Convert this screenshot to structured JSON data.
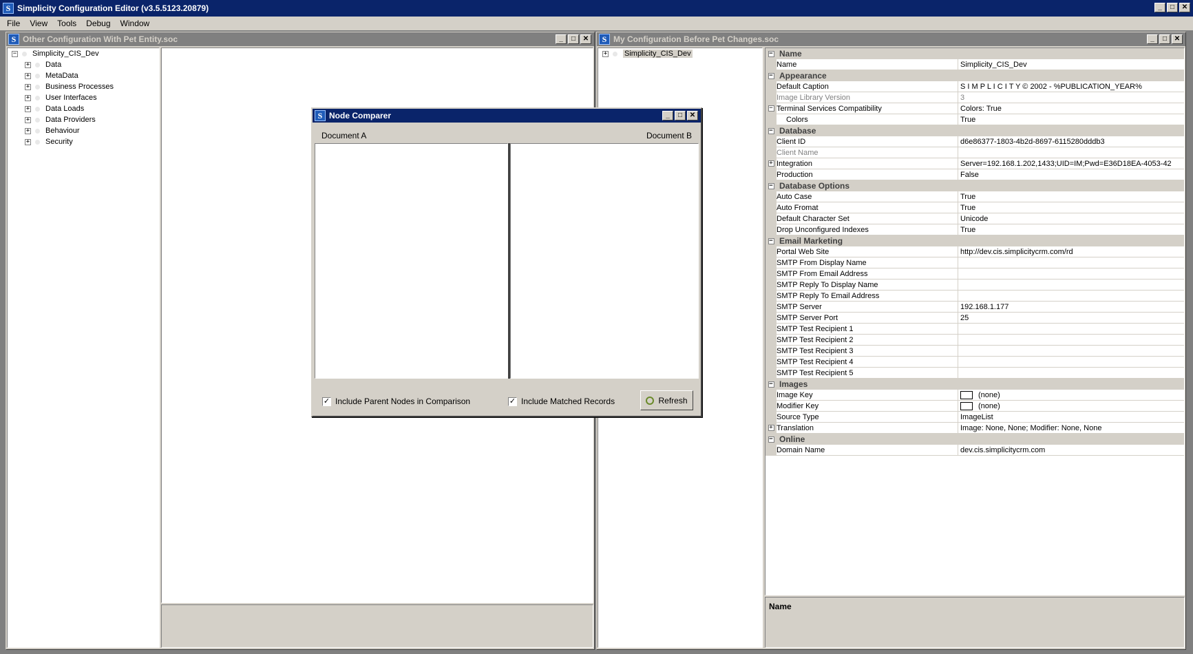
{
  "app": {
    "title": "Simplicity Configuration Editor (v3.5.5123.20879)",
    "icon_letter": "S",
    "min": "_",
    "max": "□",
    "close": "✕"
  },
  "menu": [
    "File",
    "View",
    "Tools",
    "Debug",
    "Window"
  ],
  "left_window": {
    "title": "Other Configuration With Pet Entity.soc",
    "root": "Simplicity_CIS_Dev",
    "children": [
      "Data",
      "MetaData",
      "Business Processes",
      "User Interfaces",
      "Data Loads",
      "Data Providers",
      "Behaviour",
      "Security"
    ]
  },
  "right_window": {
    "title": "My Configuration Before Pet Changes.soc",
    "root": "Simplicity_CIS_Dev",
    "description_title": "Name"
  },
  "property_grid": [
    {
      "type": "cat",
      "label": "Name"
    },
    {
      "type": "prop",
      "name": "Name",
      "value": "Simplicity_CIS_Dev"
    },
    {
      "type": "cat",
      "label": "Appearance"
    },
    {
      "type": "prop",
      "name": "Default Caption",
      "value": "S I M P L I C I T Y  ©  2002 - %PUBLICATION_YEAR%"
    },
    {
      "type": "prop",
      "name": "Image Library Version",
      "value": "3",
      "dim": true
    },
    {
      "type": "prop",
      "name": "Terminal Services Compatibility",
      "value": "Colors: True",
      "expander": "−"
    },
    {
      "type": "prop",
      "name": "Colors",
      "value": "True",
      "indent": true
    },
    {
      "type": "cat",
      "label": "Database"
    },
    {
      "type": "prop",
      "name": "Client ID",
      "value": "d6e86377-1803-4b2d-8697-6115280dddb3"
    },
    {
      "type": "prop",
      "name": "Client Name",
      "value": "",
      "dim": true
    },
    {
      "type": "prop",
      "name": "Integration",
      "value": "Server=192.168.1.202,1433;UID=IM;Pwd=E36D18EA-4053-42",
      "expander": "+"
    },
    {
      "type": "prop",
      "name": "Production",
      "value": "False"
    },
    {
      "type": "cat",
      "label": "Database Options"
    },
    {
      "type": "prop",
      "name": "Auto Case",
      "value": "True"
    },
    {
      "type": "prop",
      "name": "Auto Fromat",
      "value": "True"
    },
    {
      "type": "prop",
      "name": "Default Character Set",
      "value": "Unicode"
    },
    {
      "type": "prop",
      "name": "Drop Unconfigured Indexes",
      "value": "True"
    },
    {
      "type": "cat",
      "label": "Email Marketing"
    },
    {
      "type": "prop",
      "name": "Portal Web Site",
      "value": "http://dev.cis.simplicitycrm.com/rd"
    },
    {
      "type": "prop",
      "name": "SMTP From Display Name",
      "value": ""
    },
    {
      "type": "prop",
      "name": "SMTP From Email Address",
      "value": ""
    },
    {
      "type": "prop",
      "name": "SMTP Reply To Display Name",
      "value": ""
    },
    {
      "type": "prop",
      "name": "SMTP Reply To Email Address",
      "value": ""
    },
    {
      "type": "prop",
      "name": "SMTP Server",
      "value": "192.168.1.177"
    },
    {
      "type": "prop",
      "name": "SMTP Server Port",
      "value": "25"
    },
    {
      "type": "prop",
      "name": "SMTP Test Recipient 1",
      "value": ""
    },
    {
      "type": "prop",
      "name": "SMTP Test Recipient 2",
      "value": ""
    },
    {
      "type": "prop",
      "name": "SMTP Test Recipient 3",
      "value": ""
    },
    {
      "type": "prop",
      "name": "SMTP Test Recipient 4",
      "value": ""
    },
    {
      "type": "prop",
      "name": "SMTP Test Recipient 5",
      "value": ""
    },
    {
      "type": "cat",
      "label": "Images"
    },
    {
      "type": "prop",
      "name": "Image Key",
      "value": "(none)",
      "swatch": true
    },
    {
      "type": "prop",
      "name": "Modifier Key",
      "value": "(none)",
      "swatch": true
    },
    {
      "type": "prop",
      "name": "Source Type",
      "value": "ImageList"
    },
    {
      "type": "prop",
      "name": "Translation",
      "value": "Image: None, None; Modifier: None, None",
      "expander": "+"
    },
    {
      "type": "cat",
      "label": "Online"
    },
    {
      "type": "prop",
      "name": "Domain Name",
      "value": "dev.cis.simplicitycrm.com"
    }
  ],
  "dialog": {
    "title": "Node Comparer",
    "doc_a": "Document A",
    "doc_b": "Document B",
    "include_parent": "Include Parent Nodes in Comparison",
    "include_matched": "Include Matched Records",
    "refresh": "Refresh",
    "check": "✓"
  }
}
